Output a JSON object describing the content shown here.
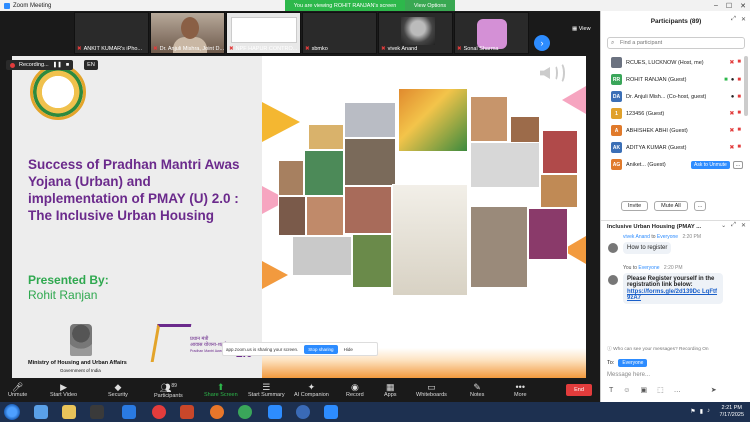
{
  "window": {
    "title": "Zoom Meeting",
    "viewing_banner": "You are viewing ROHIT RANJAN's screen",
    "view_options": "View Options"
  },
  "thumbnails": [
    {
      "name": "ANKIT KUMAR's iPho..."
    },
    {
      "name": "Dr. Anjuli Mishra, Joint D..."
    },
    {
      "name": "NPF HAPUR CONTRO..."
    },
    {
      "name": "sbmko"
    },
    {
      "name": "vivek Anand"
    },
    {
      "name": "Sonal Sharma"
    }
  ],
  "thumbnail_placeholder": "sbmko",
  "view_btn": "View",
  "recording": {
    "label": "Recording...",
    "pause": "❚❚",
    "stop": "■",
    "lang": "EN"
  },
  "slide": {
    "title": "Success of Pradhan Mantri Awas Yojana (Urban) and implementation of PMAY (U) 2.0 : The Inclusive Urban Housing",
    "presented_label": "Presented By:",
    "presenter": "Rohit Ranjan",
    "ministry": "Ministry of Housing and Urban Affairs",
    "govt": "Government of India",
    "pmay_line1": "प्रधान मंत्री",
    "pmay_line2": "आवास योजना-शहरी",
    "pmay_line3": "Pradhan Mantri Awas Yojana-Urban",
    "pmay_ver": "2.0"
  },
  "sharing_bar": {
    "text": "app.zoom.us is sharing your screen.",
    "stop": "Stop sharing",
    "hide": "Hide"
  },
  "participants": {
    "title": "Participants (89)",
    "search_placeholder": "Find a participant",
    "items": [
      {
        "initials": "",
        "name": "RCUES, LUCKNOW (Host, me)",
        "color": "#6b7280"
      },
      {
        "initials": "RR",
        "name": "ROHIT RANJAN (Guest)",
        "color": "#3aa65a"
      },
      {
        "initials": "DA",
        "name": "Dr. Anjuli Mish... (Co-host, guest)",
        "color": "#3b6fb6"
      },
      {
        "initials": "1",
        "name": "123456 (Guest)",
        "color": "#e0a12b"
      },
      {
        "initials": "A",
        "name": "ABHISHEK ABHI (Guest)",
        "color": "#e07a2b"
      },
      {
        "initials": "AK",
        "name": "ADITYA KUMAR (Guest)",
        "color": "#3b6fb6"
      },
      {
        "initials": "AG",
        "name": "Aniket... (Guest)",
        "color": "#e07a2b"
      }
    ],
    "ask_unmute": "Ask to Unmute",
    "more": "...",
    "invite": "Invite",
    "mute_all": "Mute All",
    "options": "..."
  },
  "chat": {
    "title": "Inclusive Urban Housing (PMAY ...",
    "messages": [
      {
        "from": "vivek Anand",
        "to": "Everyone",
        "time": "2:20 PM",
        "text": "How to register"
      },
      {
        "from": "You",
        "to": "Everyone",
        "time": "2:20 PM",
        "text_bold": "Please Register yourself in the registration link below:",
        "link": "https://forms.gle/2d139Dc LqFtf9zA7"
      }
    ],
    "to_word": "to",
    "who_can_see": "Who can see your messages? Recording On",
    "to_label": "To:",
    "to_value": "Everyone",
    "input_placeholder": "Message here..."
  },
  "toolbar": {
    "unmute": "Unmute",
    "start_video": "Start Video",
    "security": "Security",
    "participants": "Participants",
    "participants_count": "89",
    "share_screen": "Share Screen",
    "start_summary": "Start Summary",
    "ai_companion": "AI Companion",
    "record": "Record",
    "apps": "Apps",
    "whiteboards": "Whiteboards",
    "notes": "Notes",
    "more": "More",
    "end": "End"
  },
  "taskbar": {
    "time": "2:21 PM",
    "date": "7/17/2025"
  }
}
